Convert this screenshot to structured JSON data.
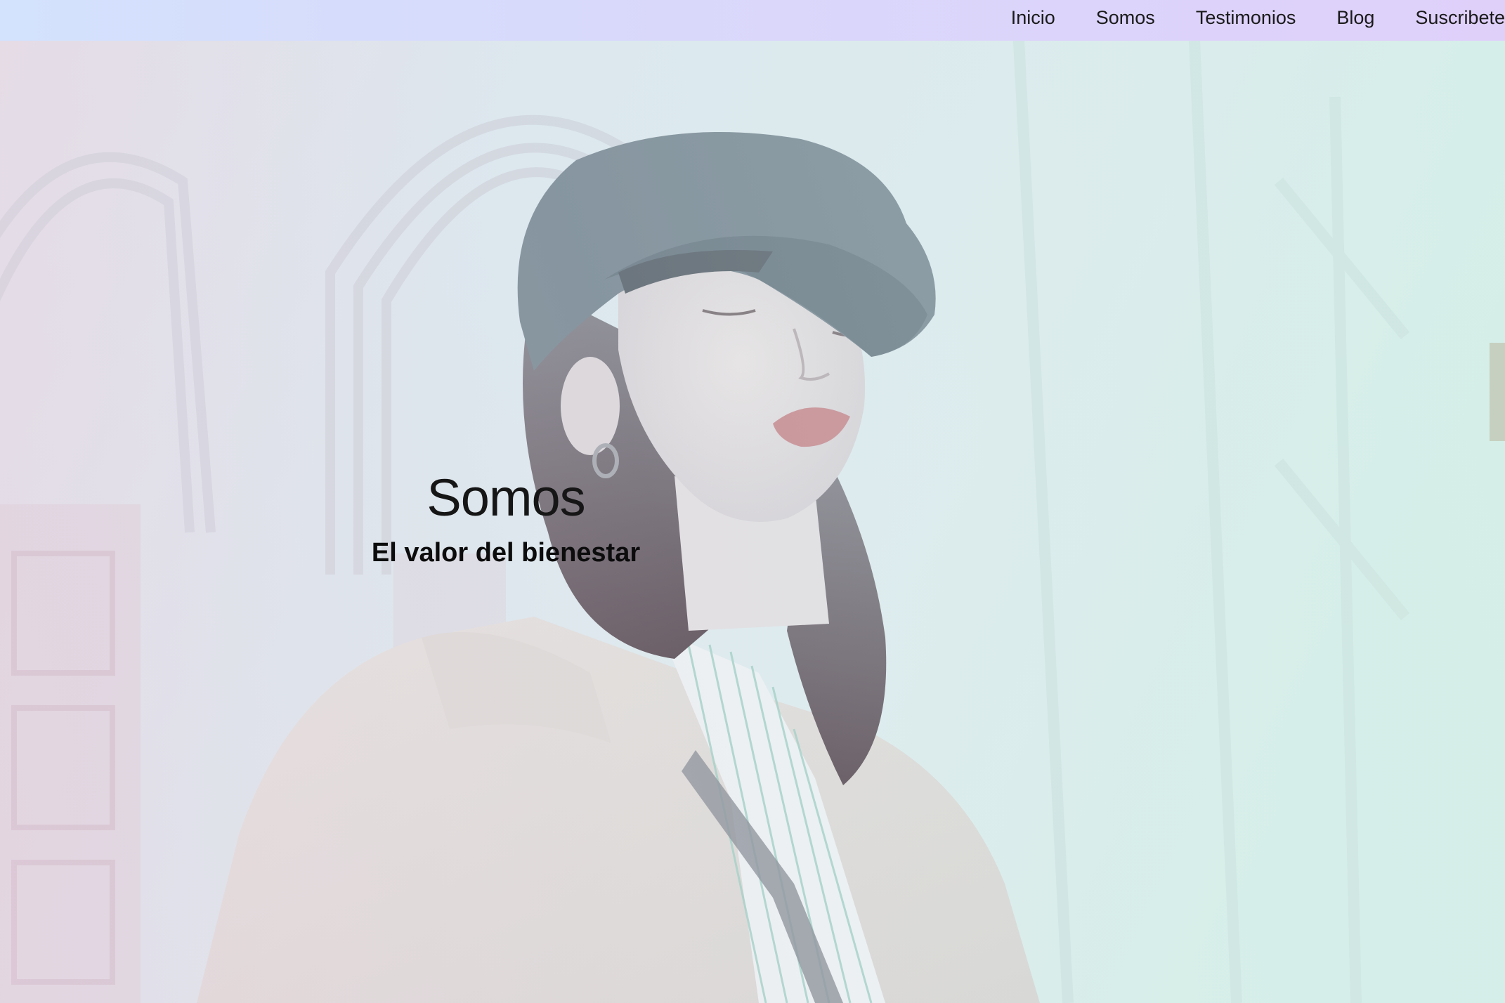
{
  "nav": {
    "items": [
      {
        "label": "Inicio"
      },
      {
        "label": "Somos"
      },
      {
        "label": "Testimonios"
      },
      {
        "label": "Blog"
      },
      {
        "label": "Suscribete"
      }
    ]
  },
  "hero": {
    "title": "Somos",
    "subtitle": "El valor del bienestar"
  },
  "colors": {
    "nav_gradient_start": "#d3e2fd",
    "nav_gradient_end": "#dfd0fa",
    "text_dark": "#161616"
  }
}
